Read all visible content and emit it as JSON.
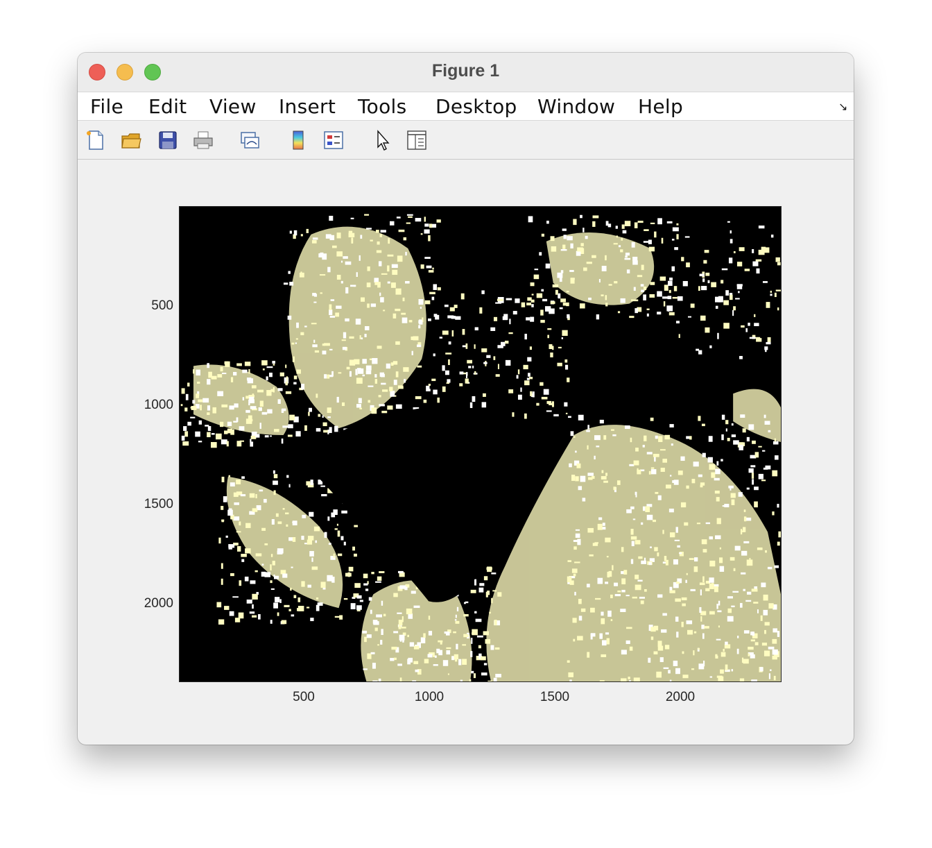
{
  "window": {
    "title": "Figure 1"
  },
  "menu": {
    "items": [
      "File",
      "Edit",
      "View",
      "Insert",
      "Tools",
      "Desktop",
      "Window",
      "Help"
    ]
  },
  "toolbar": {
    "tools": [
      "new-figure-icon",
      "open-file-icon",
      "save-icon",
      "print-icon",
      "link-plot-icon",
      "colorbar-icon",
      "legend-icon",
      "edit-plot-pointer-icon",
      "property-inspector-icon"
    ]
  },
  "chart_data": {
    "type": "heatmap",
    "description_colors": {
      "background": "#000000",
      "foreground": "#fffcc0"
    },
    "xticks": [
      500,
      1000,
      1500,
      2000
    ],
    "yticks": [
      500,
      1000,
      1500,
      2000
    ],
    "xlim": [
      1,
      2400
    ],
    "ylim": [
      1,
      2400
    ],
    "y_direction": "reverse",
    "grid": false
  }
}
